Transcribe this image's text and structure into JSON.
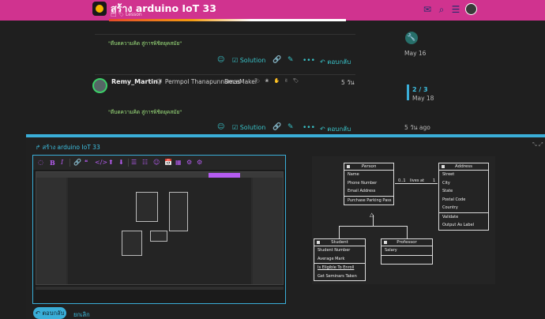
{
  "header": {
    "title": "สร้าง arduino IoT 33",
    "subtitle": "🗂 🏷 Lesson",
    "icons": [
      "mail-icon",
      "search-icon",
      "menu-icon"
    ]
  },
  "posts": [
    {
      "quote": "\"ดีบดความคิด สู่การพิชิตยุคสมัย\"",
      "actions": {
        "like": "☺",
        "solution": "Solution",
        "link": "🔗",
        "edit": "✎",
        "more": "•••",
        "reply": "ตอบกลับ"
      }
    },
    {
      "username": "Remy_Martin",
      "fullname": "Permpol Thanapunnamas",
      "team": "DecaMaker",
      "badges": "🏷 ❀ ✋ ✌ 🏷",
      "time": "5 วัน",
      "quote": "\"ดีบดความคิด สู่การพิชิตยุคสมัย\"",
      "actions": {
        "like": "☺",
        "solution": "Solution",
        "link": "🔗",
        "edit": "✎",
        "more": "•••",
        "reply": "ตอบกลับ"
      }
    }
  ],
  "timeline": {
    "top_date": "May 16",
    "count": "2 / 3",
    "current_date": "May 18",
    "bottom": "5 วัน ago"
  },
  "composer": {
    "reply_to": "สร้าง arduino IoT 33",
    "toolbar": [
      "◌",
      "B",
      "I",
      "🔗",
      "❝",
      "</>",
      "⬆",
      "⬇",
      "☰",
      "☷",
      "☺",
      "📅",
      "▦",
      "⚙",
      "⚙"
    ],
    "reply_button": "ตอบกลับ",
    "cancel": "ยกเลิก"
  },
  "preview_uml": {
    "classes": [
      {
        "name": "Person",
        "italic": true,
        "sections": [
          [
            "Name",
            "Phone Number",
            "Email Address"
          ],
          [
            "Purchase Parking Pass"
          ]
        ]
      },
      {
        "name": "Address",
        "italic": false,
        "sections": [
          [
            "Street",
            "City",
            "State",
            "Postal Code",
            "Country"
          ],
          [
            "Validate",
            "Output As Label"
          ]
        ]
      },
      {
        "name": "Student",
        "italic": false,
        "sections": [
          [
            "Student Number",
            "Average Mark"
          ],
          [
            "Is Eligible To Enroll",
            "Get Seminars Taken"
          ]
        ]
      },
      {
        "name": "Professor",
        "italic": false,
        "sections": [
          [
            "Salary"
          ],
          []
        ]
      }
    ],
    "association": {
      "label": "lives at",
      "left_mult": "0..1",
      "right_mult": "1"
    }
  },
  "colors": {
    "header": "#d0338f",
    "accent": "#3aaed8",
    "quote": "#9ee37d",
    "toolbar_icon": "#b55cf0"
  }
}
